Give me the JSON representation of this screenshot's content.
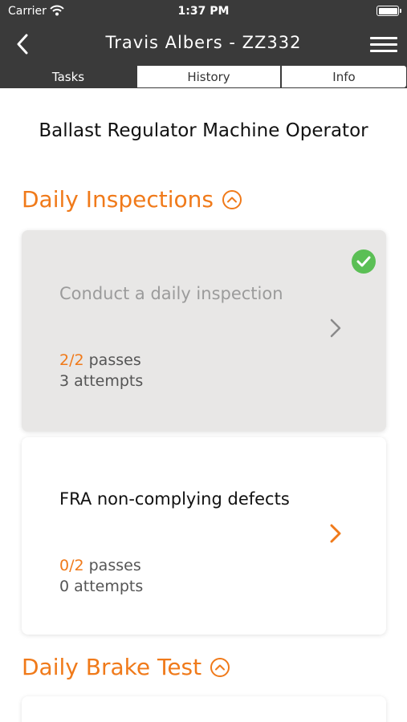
{
  "status_bar": {
    "carrier": "Carrier",
    "time": "1:37 PM"
  },
  "nav": {
    "title": "Travis Albers - ZZ332"
  },
  "tabs": [
    {
      "label": "Tasks",
      "active": true
    },
    {
      "label": "History",
      "active": false
    },
    {
      "label": "Info",
      "active": false
    }
  ],
  "role": "Ballast Regulator Machine Operator",
  "sections": [
    {
      "title": "Daily Inspections",
      "tasks": [
        {
          "title": "Conduct a daily inspection",
          "passes_count": "2/2",
          "passes_label": "passes",
          "attempts": "3 attempts",
          "completed": true
        },
        {
          "title": "FRA non-complying defects",
          "passes_count": "0/2",
          "passes_label": "passes",
          "attempts": "0 attempts",
          "completed": false
        }
      ]
    },
    {
      "title": "Daily Brake Test",
      "tasks": []
    }
  ],
  "colors": {
    "accent": "#f07a1a",
    "header_bg": "#3a3a3a",
    "success": "#5bbf55",
    "completed_card": "#e8e7e6"
  },
  "icons": [
    "back-chevron-icon",
    "wifi-icon",
    "battery-icon",
    "hamburger-menu-icon",
    "collapse-chevron-up-icon",
    "chevron-right-icon",
    "checkmark-icon"
  ]
}
